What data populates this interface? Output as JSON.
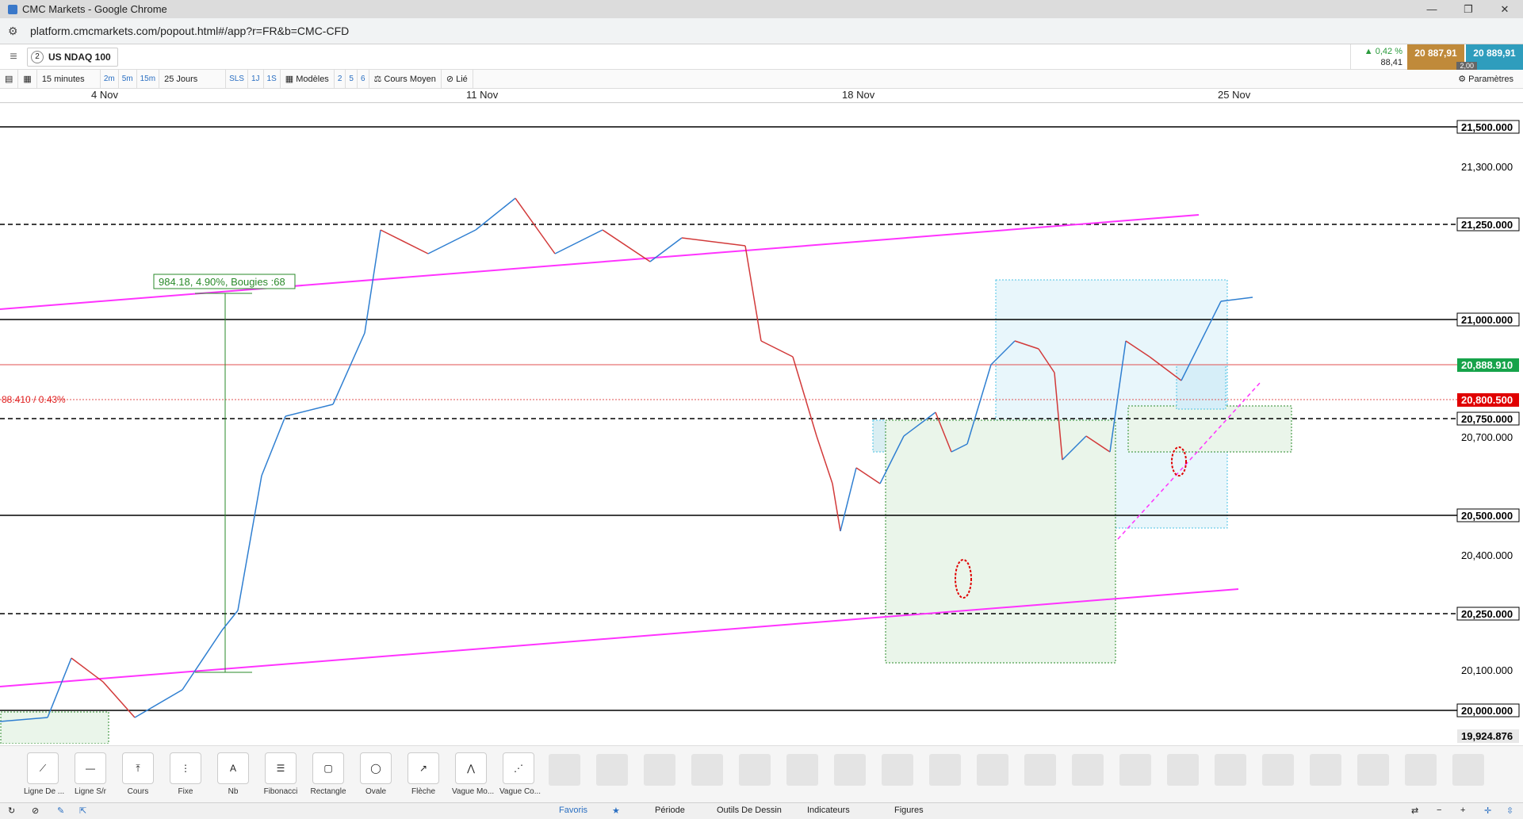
{
  "window": {
    "title": "CMC Markets - Google Chrome",
    "url": "platform.cmcmarkets.com/popout.html#/app?r=FR&b=CMC-CFD"
  },
  "instrument": {
    "index": "2",
    "name": "US NDAQ 100"
  },
  "quote": {
    "change_pct": "▲ 0,42 %",
    "change_pts": "88,41",
    "sell": "20 887,91",
    "buy": "20 889,91",
    "spread": "2,00"
  },
  "toolbar": {
    "interval": "15 minutes",
    "i2m": "2m",
    "i5m": "5m",
    "i15m": "15m",
    "range": "25 Jours",
    "sls": "SLS",
    "d1": "1J",
    "w1": "1S",
    "models": "Modèles",
    "n2": "2",
    "n5": "5",
    "n6": "6",
    "avg": "Cours Moyen",
    "link": "Lié",
    "params": "Paramètres"
  },
  "dates": [
    "4 Nov",
    "11 Nov",
    "18 Nov",
    "25 Nov"
  ],
  "chart": {
    "measure_label": "984.18, 4.90%, Bougies :68",
    "change_label": "88.410 / 0.43%",
    "price_labels": {
      "p21500": "21,500.000",
      "p21300": "21,300.000",
      "p21250": "21,250.000",
      "p21000": "21,000.000",
      "pcur": "20,888.910",
      "p20800": "20,800.500",
      "p20750": "20,750.000",
      "p20700": "20,700.000",
      "p20500": "20,500.000",
      "p20400": "20,400.000",
      "p20250": "20,250.000",
      "p20100": "20,100.000",
      "p20000": "20,000.000",
      "plow": "19,924.876"
    },
    "colors": {
      "channel": "#ff33ff",
      "current": "#e02020",
      "red_tag": "#e00000",
      "green_tag": "#16a34a"
    }
  },
  "draw_tools": [
    {
      "label": "Ligne De ..."
    },
    {
      "label": "Ligne S/r"
    },
    {
      "label": "Cours"
    },
    {
      "label": "Fixe"
    },
    {
      "label": "Nb"
    },
    {
      "label": "Fibonacci"
    },
    {
      "label": "Rectangle"
    },
    {
      "label": "Ovale"
    },
    {
      "label": "Flèche"
    },
    {
      "label": "Vague Mo..."
    },
    {
      "label": "Vague Co..."
    }
  ],
  "bottom_tabs": {
    "favoris": "Favoris",
    "periode": "Période",
    "outils": "Outils De Dessin",
    "indicateurs": "Indicateurs",
    "figures": "Figures"
  }
}
